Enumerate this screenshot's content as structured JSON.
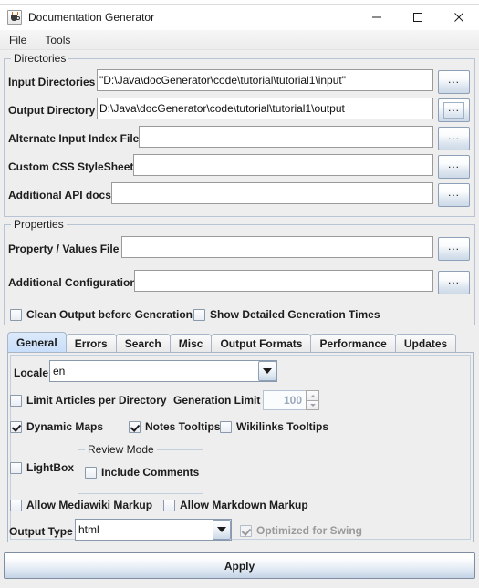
{
  "window": {
    "title": "Documentation Generator",
    "icon": "java-cup-icon",
    "controls": {
      "minimize": "minimize-icon",
      "maximize": "maximize-icon",
      "close": "close-icon"
    }
  },
  "menubar": {
    "items": [
      {
        "label": "File"
      },
      {
        "label": "Tools"
      }
    ]
  },
  "directories": {
    "title": "Directories",
    "browse_label": "...",
    "rows": [
      {
        "label": "Input Directories",
        "value": "\"D:\\Java\\docGenerator\\code\\tutorial\\tutorial1\\input\"",
        "focused": false
      },
      {
        "label": "Output Directory",
        "value": "D:\\Java\\docGenerator\\code\\tutorial\\tutorial1\\output",
        "focused": true
      },
      {
        "label": "Alternate Input Index File",
        "value": "",
        "focused": false
      },
      {
        "label": "Custom CSS StyleSheet",
        "value": "",
        "focused": false
      },
      {
        "label": "Additional API docs",
        "value": "",
        "focused": false
      }
    ]
  },
  "properties": {
    "title": "Properties",
    "browse_label": "...",
    "rows": [
      {
        "label": "Property / Values File",
        "value": ""
      },
      {
        "label": "Additional Configuration",
        "value": ""
      }
    ]
  },
  "global_options": [
    {
      "label": "Clean Output before Generation",
      "checked": false
    },
    {
      "label": "Show Detailed Generation Times",
      "checked": false
    }
  ],
  "tabs": {
    "active": "General",
    "items": [
      {
        "label": "General"
      },
      {
        "label": "Errors"
      },
      {
        "label": "Search"
      },
      {
        "label": "Misc"
      },
      {
        "label": "Output Formats"
      },
      {
        "label": "Performance"
      },
      {
        "label": "Updates"
      }
    ]
  },
  "general_panel": {
    "locale": {
      "label": "Locale",
      "value": "en",
      "icon": "chevron-down-icon"
    },
    "limit_articles": {
      "label": "Limit Articles per Directory",
      "checked": false
    },
    "generation_limit": {
      "label": "Generation Limit",
      "value": "100",
      "disabled": true
    },
    "toggles_row": [
      {
        "label": "Dynamic Maps",
        "checked": true
      },
      {
        "label": "Notes Tooltips",
        "checked": true
      },
      {
        "label": "Wikilinks Tooltips",
        "checked": false
      }
    ],
    "lightbox": {
      "label": "LightBox",
      "checked": false
    },
    "review_mode": {
      "title": "Review Mode",
      "include_comments": {
        "label": "Include Comments",
        "checked": false
      }
    },
    "markup_row": [
      {
        "label": "Allow Mediawiki Markup",
        "checked": false
      },
      {
        "label": "Allow Markdown Markup",
        "checked": false
      }
    ],
    "output_type": {
      "label": "Output Type",
      "value": "html",
      "icon": "chevron-down-icon"
    },
    "optimized_for_swing": {
      "label": "Optimized for Swing",
      "checked": true,
      "disabled": true
    }
  },
  "footer": {
    "apply_label": "Apply"
  },
  "colors": {
    "accent": "#c9defa",
    "panel": "#eeeeee",
    "border": "#a8b6c8"
  }
}
